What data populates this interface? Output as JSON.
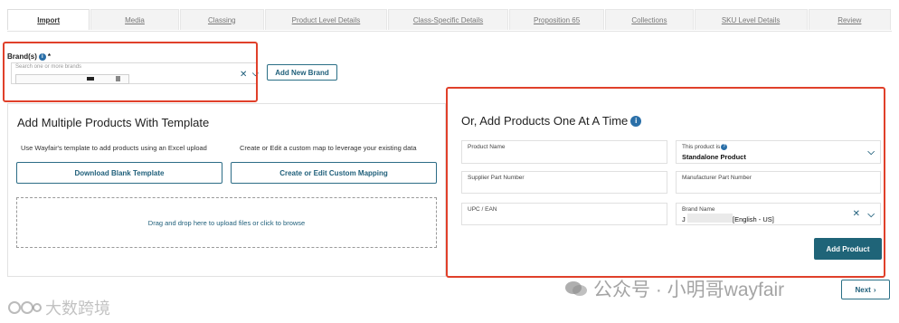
{
  "tabs": [
    {
      "label": "Import",
      "active": true
    },
    {
      "label": "Media",
      "active": false
    },
    {
      "label": "Classing",
      "active": false
    },
    {
      "label": "Product Level Details",
      "active": false
    },
    {
      "label": "Class-Specific Details",
      "active": false
    },
    {
      "label": "Proposition 65",
      "active": false
    },
    {
      "label": "Collections",
      "active": false
    },
    {
      "label": "SKU Level Details",
      "active": false
    },
    {
      "label": "Review",
      "active": false
    }
  ],
  "brand": {
    "label": "Brand(s)",
    "required_mark": "*",
    "placeholder": "Search one or more brands",
    "add_button": "Add New Brand"
  },
  "template_panel": {
    "title": "Add Multiple Products With Template",
    "desc_left": "Use Wayfair's template to add products using an Excel upload",
    "desc_right": "Create or Edit a custom map to leverage your existing data",
    "download_button": "Download Blank Template",
    "mapping_button": "Create or Edit Custom Mapping",
    "dropzone_text": "Drag and drop here to upload files or click to browse"
  },
  "single_panel": {
    "title": "Or, Add Products One At A Time",
    "product_name_label": "Product Name",
    "product_kind_label": "This product is",
    "product_kind_value": "Standalone Product",
    "supplier_part_label": "Supplier Part Number",
    "manufacturer_part_label": "Manufacturer Part Number",
    "upc_label": "UPC / EAN",
    "brand_name_label": "Brand Name",
    "brand_name_prefix": "J",
    "brand_name_value": "[English - US]",
    "add_product_button": "Add Product"
  },
  "nav": {
    "next_button": "Next"
  },
  "watermark": {
    "right": "公众号 · 小明哥wayfair",
    "left": "大数跨境"
  },
  "colors": {
    "accent": "#1f6478",
    "highlight": "#e0402a"
  }
}
